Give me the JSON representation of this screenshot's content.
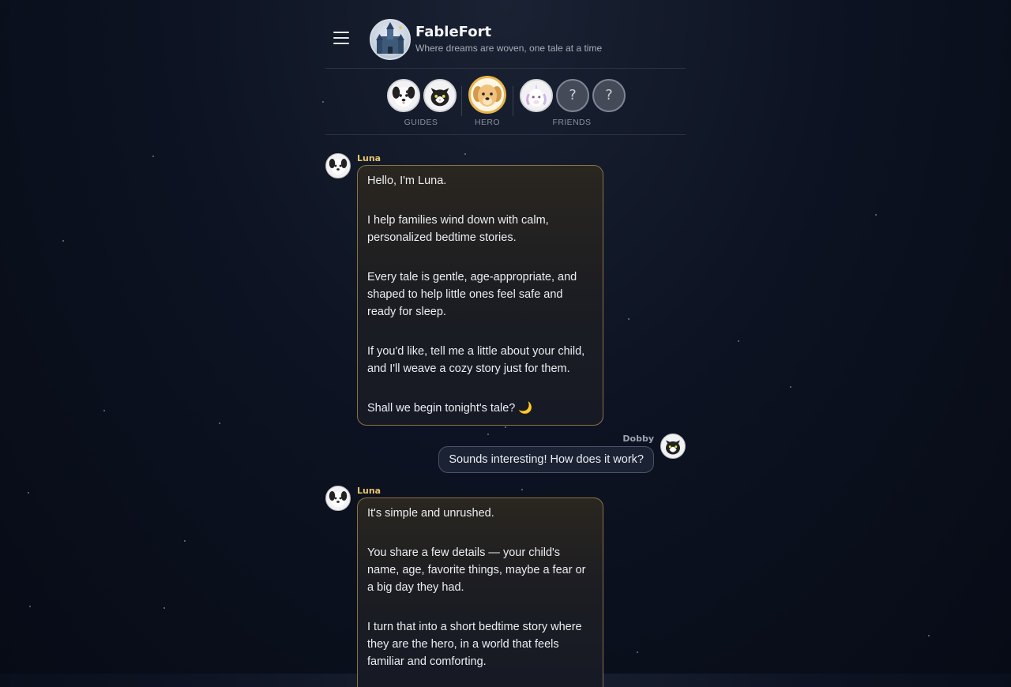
{
  "app": {
    "title": "FableFort",
    "tagline": "Where dreams are woven, one tale at a time",
    "menu_icon": "hamburger-menu-icon",
    "logo_icon": "castle-icon"
  },
  "cast": {
    "guides_label": "GUIDES",
    "hero_label": "HERO",
    "friends_label": "FRIENDS",
    "guides": [
      {
        "name": "Luna",
        "icon": "dalmatian-dog-icon"
      },
      {
        "name": "Dobby",
        "icon": "tuxedo-cat-icon"
      }
    ],
    "hero": {
      "icon": "golden-retriever-icon"
    },
    "friends": [
      {
        "icon": "unicorn-icon"
      },
      {
        "placeholder": "?"
      },
      {
        "placeholder": "?"
      }
    ]
  },
  "messages": [
    {
      "sender": "Luna",
      "paragraphs": [
        "Hello, I'm Luna.",
        "I help families wind down with calm, personalized bedtime stories.",
        "Every tale is gentle, age-appropriate, and shaped to help little ones feel safe and ready for sleep.",
        "If you'd like, tell me a little about your child, and I'll weave a cozy story just for them.",
        "Shall we begin tonight's tale? 🌙"
      ]
    },
    {
      "sender": "Dobby",
      "text": "Sounds interesting! How does it work?"
    },
    {
      "sender": "Luna",
      "paragraphs": [
        "It's simple and unrushed.",
        "You share a few details — your child's name, age, favorite things, maybe a fear or a big day they had.",
        "I turn that into a short bedtime story where they are the hero, in a world that feels familiar and comforting."
      ]
    }
  ],
  "colors": {
    "accent_gold": "#e8b44c",
    "luna_name": "#e9c46a",
    "bot_bubble_border": "#8a7344",
    "user_bubble_border": "#4a5368"
  }
}
